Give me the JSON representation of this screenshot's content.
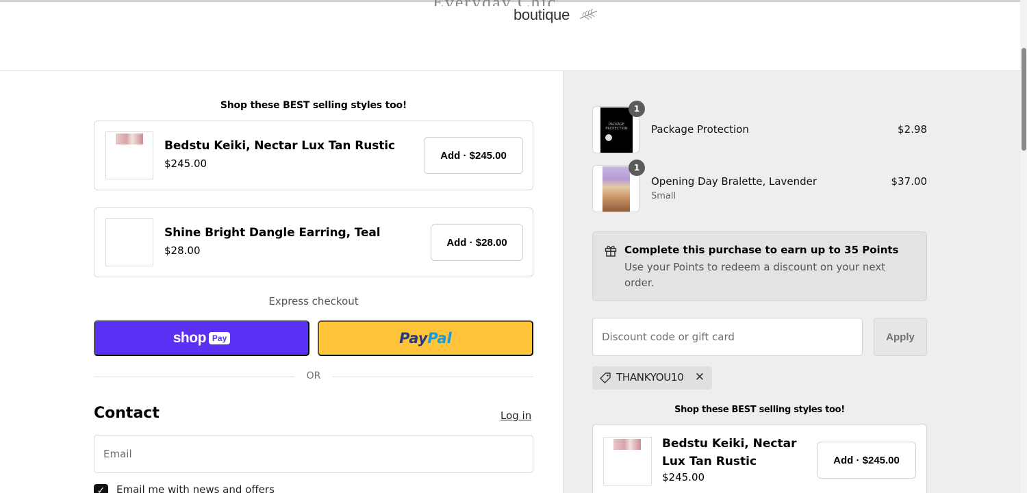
{
  "header": {
    "logo_top": "Everyday Chic",
    "logo_text": "boutique"
  },
  "upsell_left": {
    "heading": "Shop these BEST selling styles too!",
    "items": [
      {
        "name": "Bedstu Keiki, Nectar Lux Tan Rustic",
        "price": "$245.00",
        "button": "Add · $245.00"
      },
      {
        "name": "Shine Bright Dangle Earring, Teal",
        "price": "$28.00",
        "button": "Add · $28.00"
      }
    ]
  },
  "express": {
    "label": "Express checkout",
    "shoppay_word": "shop",
    "shoppay_badge": "Pay",
    "paypal_pay": "Pay",
    "paypal_pal": "Pal",
    "or_text": "OR"
  },
  "contact": {
    "title": "Contact",
    "login": "Log in",
    "email_placeholder": "Email",
    "newsletter_label": "Email me with news and offers",
    "newsletter_checked": true
  },
  "order_summary": {
    "items": [
      {
        "name": "Package Protection",
        "variant": "",
        "price": "$2.98",
        "quantity": "1",
        "thumb_text": "PACKAGE PROTECTION"
      },
      {
        "name": "Opening Day Bralette, Lavender",
        "variant": "Small",
        "price": "$37.00",
        "quantity": "1"
      }
    ]
  },
  "points": {
    "title": "Complete this purchase to earn up to 35 Points",
    "text": "Use your Points to redeem a discount on your next order."
  },
  "discount": {
    "placeholder": "Discount code or gift card",
    "apply": "Apply",
    "applied_code": "THANKYOU10"
  },
  "upsell_right": {
    "heading": "Shop these BEST selling styles too!",
    "items": [
      {
        "name": "Bedstu Keiki, Nectar Lux Tan Rustic",
        "price": "$245.00",
        "button": "Add · $245.00"
      }
    ]
  },
  "colors": {
    "shoppay": "#5a31f4",
    "paypal": "#ffc439",
    "summary_bg": "#eeeeee"
  }
}
